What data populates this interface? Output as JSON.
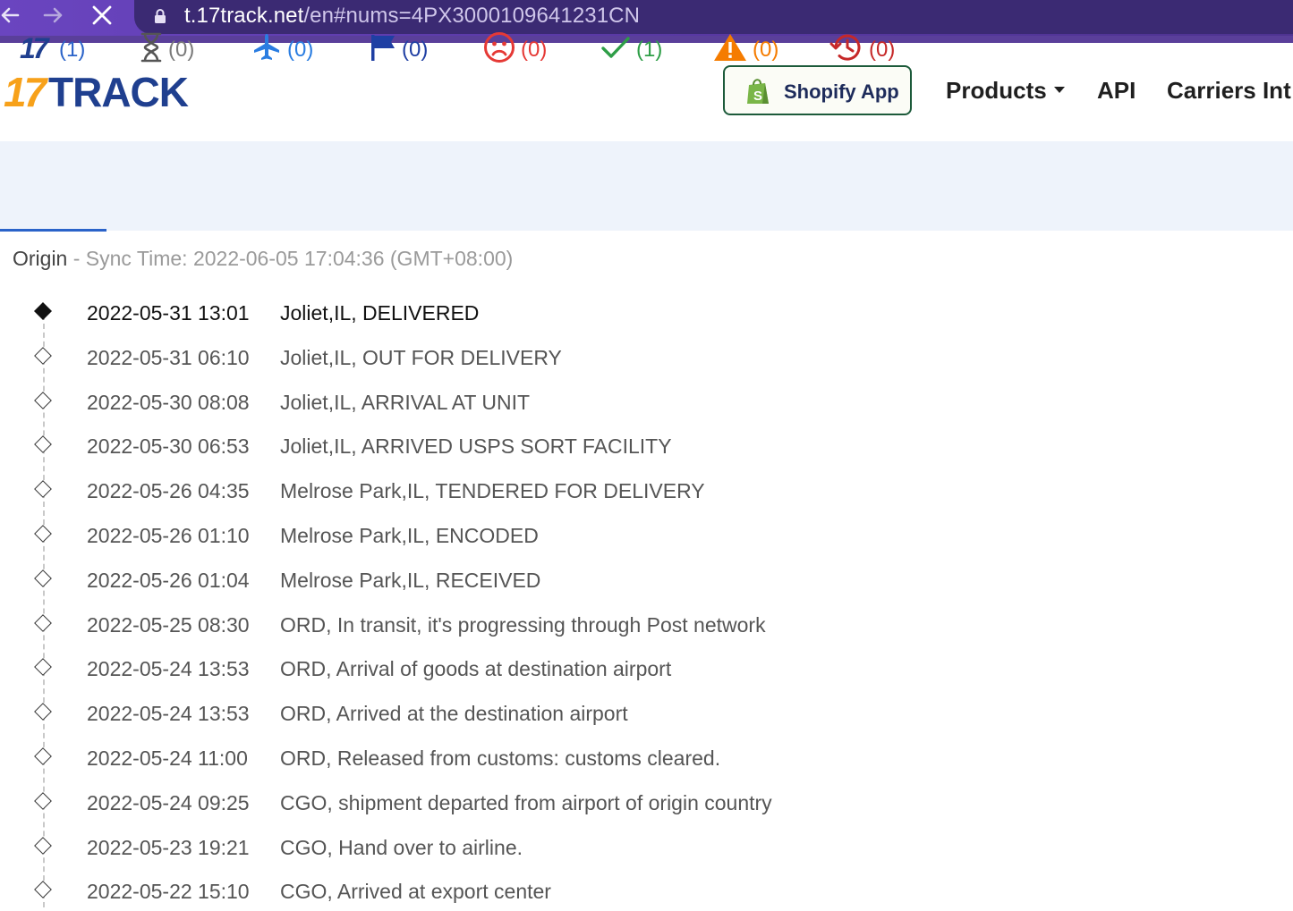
{
  "browser": {
    "url_host": "t.17track.net",
    "url_path": "/en#nums=4PX3000109641231CN",
    "back_icon": "arrow-left-icon",
    "forward_icon": "arrow-right-icon",
    "stop_icon": "close-icon"
  },
  "header": {
    "logo_text_number": "17",
    "logo_text_brand": "TRACK",
    "shopify_label": "Shopify App",
    "menu": {
      "products": "Products",
      "api": "API",
      "carriers": "Carriers Int"
    }
  },
  "filters": [
    {
      "icon": "17track-logo-icon",
      "count": "(1)",
      "color": "#2a63c9"
    },
    {
      "icon": "hourglass-icon",
      "count": "(0)",
      "color": "#7a7a7a"
    },
    {
      "icon": "airplane-icon",
      "count": "(0)",
      "color": "#2a7de1"
    },
    {
      "icon": "flag-icon",
      "count": "(0)",
      "color": "#1f3fa3"
    },
    {
      "icon": "sad-face-icon",
      "count": "(0)",
      "color": "#e53935"
    },
    {
      "icon": "checkmark-icon",
      "count": "(1)",
      "color": "#2e9e47"
    },
    {
      "icon": "warning-icon",
      "count": "(0)",
      "color": "#f57c00"
    },
    {
      "icon": "history-icon",
      "count": "(0)",
      "color": "#c62828"
    }
  ],
  "origin": {
    "label": "Origin",
    "sync": " - Sync Time: 2022-06-05 17:04:36 (GMT+08:00)"
  },
  "events": [
    {
      "time": "2022-05-31 13:01",
      "desc": "Joliet,IL, DELIVERED"
    },
    {
      "time": "2022-05-31 06:10",
      "desc": "Joliet,IL, OUT FOR DELIVERY"
    },
    {
      "time": "2022-05-30 08:08",
      "desc": "Joliet,IL, ARRIVAL AT UNIT"
    },
    {
      "time": "2022-05-30 06:53",
      "desc": "Joliet,IL, ARRIVED USPS SORT FACILITY"
    },
    {
      "time": "2022-05-26 04:35",
      "desc": "Melrose Park,IL, TENDERED FOR DELIVERY"
    },
    {
      "time": "2022-05-26 01:10",
      "desc": "Melrose Park,IL, ENCODED"
    },
    {
      "time": "2022-05-26 01:04",
      "desc": "Melrose Park,IL, RECEIVED"
    },
    {
      "time": "2022-05-25 08:30",
      "desc": "ORD, In transit, it's progressing through Post network"
    },
    {
      "time": "2022-05-24 13:53",
      "desc": "ORD, Arrival of goods at destination airport"
    },
    {
      "time": "2022-05-24 13:53",
      "desc": "ORD, Arrived at the destination airport"
    },
    {
      "time": "2022-05-24 11:00",
      "desc": "ORD, Released from customs: customs cleared."
    },
    {
      "time": "2022-05-24 09:25",
      "desc": "CGO, shipment departed from airport of origin country"
    },
    {
      "time": "2022-05-23 19:21",
      "desc": "CGO, Hand over to airline."
    },
    {
      "time": "2022-05-22 15:10",
      "desc": "CGO, Arrived at export center"
    }
  ]
}
